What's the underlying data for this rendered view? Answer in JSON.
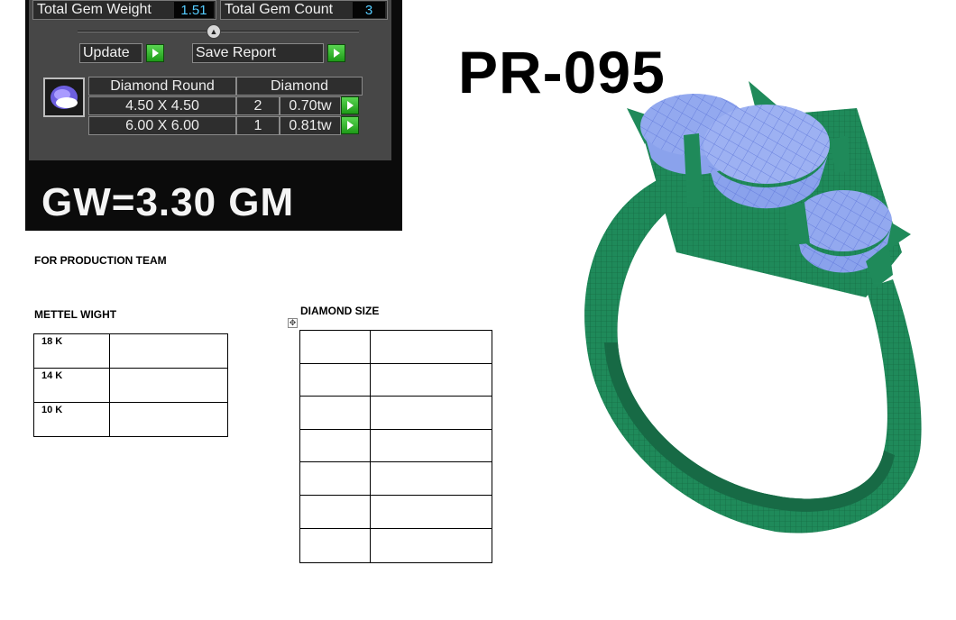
{
  "panel": {
    "total_gem_weight_label": "Total Gem Weight",
    "total_gem_weight_value": "1.51",
    "total_gem_count_label": "Total Gem Count",
    "total_gem_count_value": "3",
    "update_label": "Update",
    "save_report_label": "Save Report",
    "gem_table": {
      "headers": [
        "Diamond Round",
        "Diamond"
      ],
      "rows": [
        {
          "size": "4.50 X 4.50",
          "count": "2",
          "weight": "0.70tw"
        },
        {
          "size": "6.00 X 6.00",
          "count": "1",
          "weight": "0.81tw"
        }
      ]
    }
  },
  "gw_text": "GW=3.30 GM",
  "product_code": "PR-095",
  "doc": {
    "production_label": "FOR PRODUCTION TEAM",
    "metal_label": "METTEL WIGHT",
    "diamond_label": "DIAMOND SIZE",
    "metal_rows": [
      "18 K",
      "14 K",
      "10 K"
    ]
  },
  "colors": {
    "ring_metal": "#1f8a5a",
    "gem_blue": "#93a9ef",
    "panel_bg": "#474747",
    "value_text": "#55ccff"
  }
}
